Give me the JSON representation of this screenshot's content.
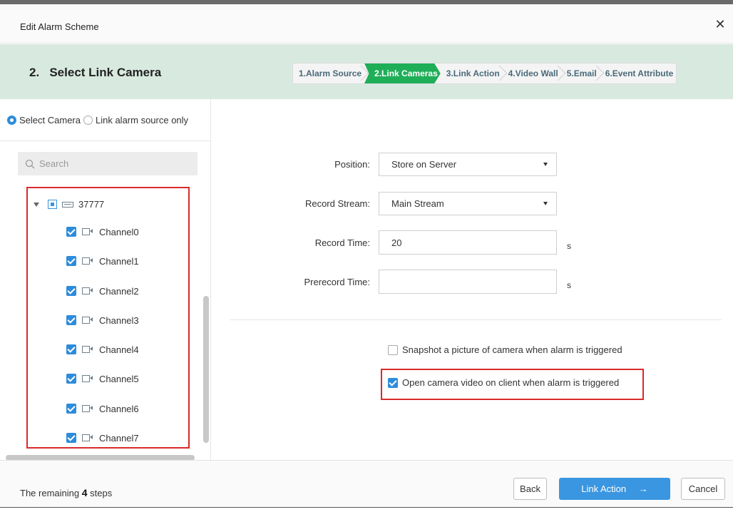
{
  "dialog": {
    "title": "Edit Alarm Scheme",
    "close_icon": "close-icon"
  },
  "stepbar": {
    "heading": "2.   Select Link Camera",
    "steps": [
      {
        "label": "1.Alarm Source",
        "active": false
      },
      {
        "label": "2.Link Cameras",
        "active": true
      },
      {
        "label": "3.Link Action",
        "active": false
      },
      {
        "label": "4.Video Wall",
        "active": false
      },
      {
        "label": "5.Email",
        "active": false
      },
      {
        "label": "6.Event Attribute",
        "active": false
      }
    ],
    "active_color": "#1fae58"
  },
  "left": {
    "radio_select_camera": "Select Camera",
    "radio_link_only": "Link alarm source only",
    "selected_radio": "Select Camera",
    "search_placeholder": "Search",
    "tree": {
      "root_label": "37777",
      "channels": [
        {
          "label": "Channel0",
          "checked": true
        },
        {
          "label": "Channel1",
          "checked": true
        },
        {
          "label": "Channel2",
          "checked": true
        },
        {
          "label": "Channel3",
          "checked": true
        },
        {
          "label": "Channel4",
          "checked": true
        },
        {
          "label": "Channel5",
          "checked": true
        },
        {
          "label": "Channel6",
          "checked": true
        },
        {
          "label": "Channel7",
          "checked": true
        }
      ]
    }
  },
  "right": {
    "position_label": "Position:",
    "position_value": "Store on Server",
    "stream_label": "Record Stream:",
    "stream_value": "Main Stream",
    "record_time_label": "Record Time:",
    "record_time_value": "20",
    "record_time_unit": "s",
    "prerecord_label": "Prerecord Time:",
    "prerecord_value": "",
    "prerecord_unit": "s",
    "snapshot_label": "Snapshot a picture of camera when alarm is triggered",
    "snapshot_checked": false,
    "open_video_label": "Open camera video on client when alarm is triggered",
    "open_video_checked": true
  },
  "footer": {
    "remaining_prefix": "The remaining",
    "remaining_count": "4",
    "remaining_suffix": "steps",
    "back_label": "Back",
    "next_label": "Link Action",
    "next_arrow": "→",
    "cancel_label": "Cancel"
  },
  "colors": {
    "accent": "#3a96e0",
    "highlight_border": "#d92a2a"
  }
}
